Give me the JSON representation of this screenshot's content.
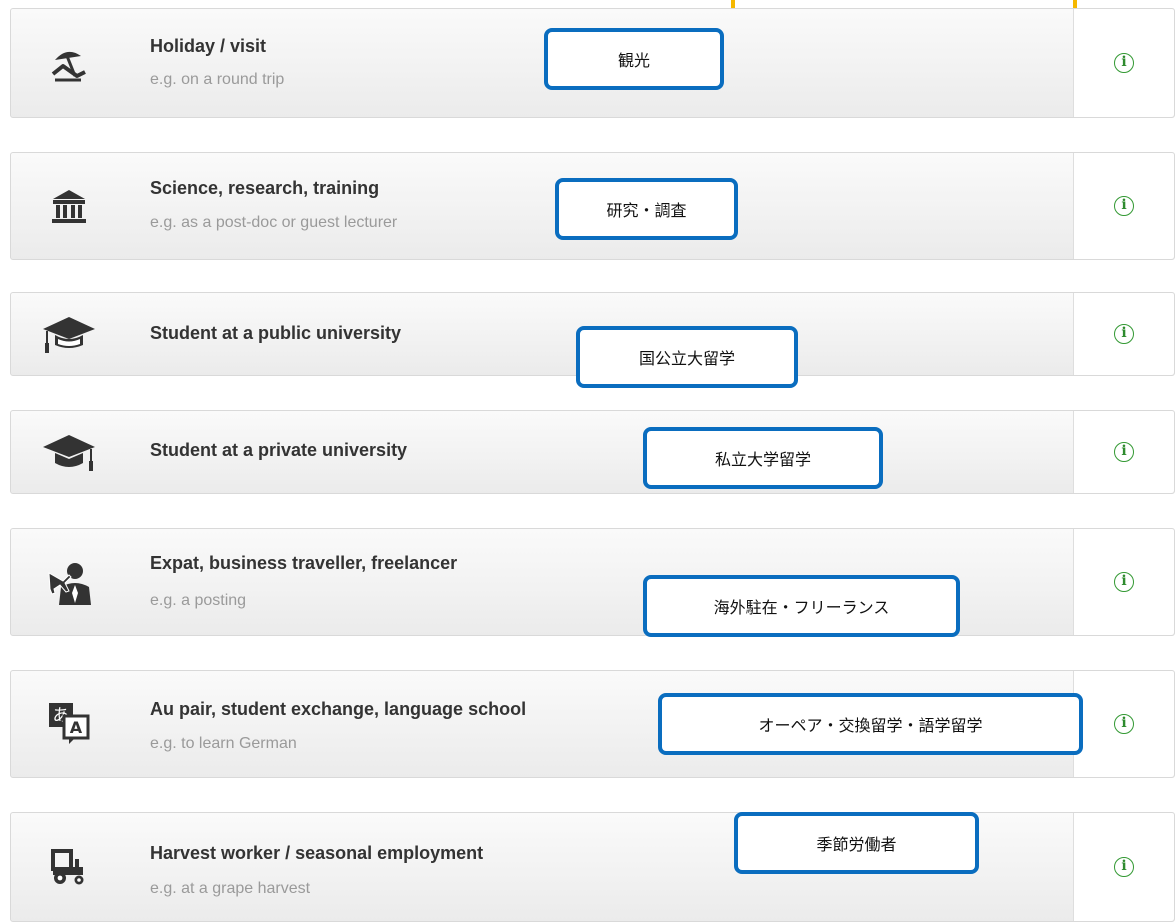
{
  "options": [
    {
      "icon": "beach-umbrella-lounger-icon",
      "title": "Holiday / visit",
      "example": "e.g. on a round trip",
      "callout": "観光"
    },
    {
      "icon": "university-building-icon",
      "title": "Science, research, training",
      "example": "e.g. as a post-doc or guest lecturer",
      "callout": "研究・調査"
    },
    {
      "icon": "graduation-cap-outline-icon",
      "title": "Student at a public university",
      "callout": "国公立大留学"
    },
    {
      "icon": "graduation-cap-icon",
      "title": "Student at a private university",
      "callout": "私立大学留学"
    },
    {
      "icon": "business-traveller-airplane-icon",
      "title": "Expat, business traveller, freelancer",
      "example": "e.g. a posting",
      "callout": "海外駐在・フリーランス"
    },
    {
      "icon": "language-translation-icon",
      "title": "Au pair, student exchange, language school",
      "example": "e.g. to learn German",
      "callout": "オーペア・交換留学・語学留学"
    },
    {
      "icon": "tractor-icon",
      "title": "Harvest worker / seasonal employment",
      "example": "e.g. at a grape harvest",
      "callout": "季節労働者"
    }
  ],
  "info_icon_glyph": "i",
  "language_icon_glyphs": {
    "kana": "あ",
    "latin": "A"
  },
  "colors": {
    "info_green": "#2e8b2e",
    "callout_blue": "#0a6dbf",
    "highlight_yellow": "#f5b800",
    "icon_dark": "#333333"
  }
}
